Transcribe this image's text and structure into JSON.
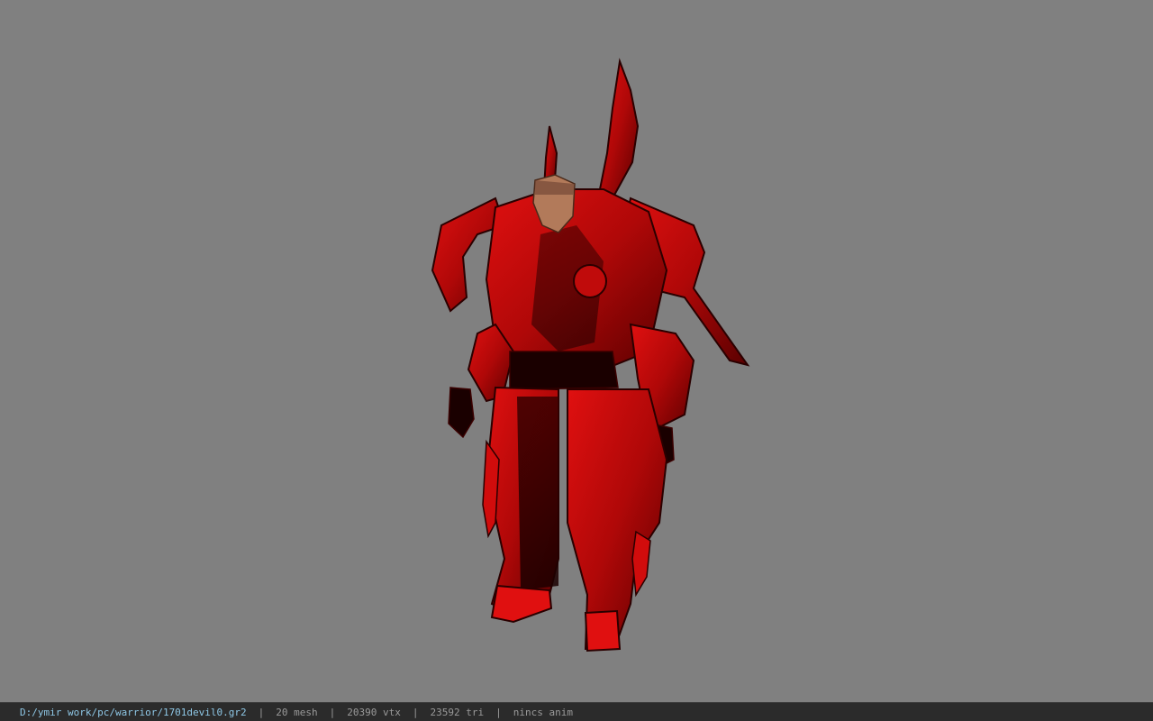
{
  "viewer": {
    "background_color": "#808080",
    "model_description_icon": "armored-warrior-model"
  },
  "status_bar": {
    "file_path": "D:/ymir work/pc/warrior/1701devil0.gr2",
    "separator": "|",
    "mesh": "20 mesh",
    "vtx": "20390 vtx",
    "tri": "23592 tri",
    "anim": "nincs anim"
  }
}
